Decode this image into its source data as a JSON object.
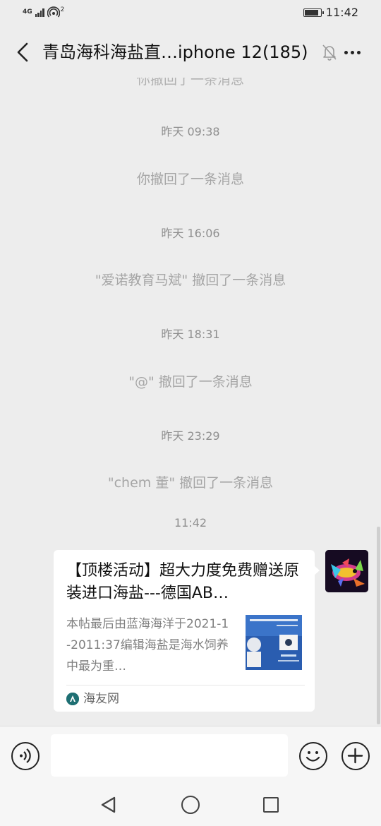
{
  "status_bar": {
    "network": "4G",
    "hotspot_superscript": "2",
    "battery_level": 0.9,
    "time": "11:42"
  },
  "header": {
    "title": "青岛海科海盐直…iphone 12(185)",
    "muted": true
  },
  "messages": {
    "partial_top": "你撤回了一条消息",
    "ts1": "昨天 09:38",
    "recall1": "你撤回了一条消息",
    "ts2": "昨天 16:06",
    "recall2": "\"爱诺教育马斌\" 撤回了一条消息",
    "ts3": "昨天 18:31",
    "recall3": "\"@\" 撤回了一条消息",
    "ts4": "昨天 23:29",
    "recall4": "\"chem 董\" 撤回了一条消息",
    "ts5": "11:42"
  },
  "link_card": {
    "title": "【顶楼活动】超大力度免费赠送原装进口海盐---德国AB…",
    "description": "本帖最后由蓝海海洋于2021-1-2011:37编辑海盐是海水饲养中最为重…",
    "source": "海友网"
  },
  "input": {
    "value": "",
    "placeholder": ""
  },
  "colors": {
    "background": "#ededed",
    "card": "#ffffff",
    "system_text": "#a5a5a5"
  },
  "icons": {
    "back": "chevron-left-icon",
    "mute": "bell-off-icon",
    "more": "more-dots-icon",
    "voice": "voice-icon",
    "emoji": "smiley-icon",
    "plus": "plus-icon"
  }
}
